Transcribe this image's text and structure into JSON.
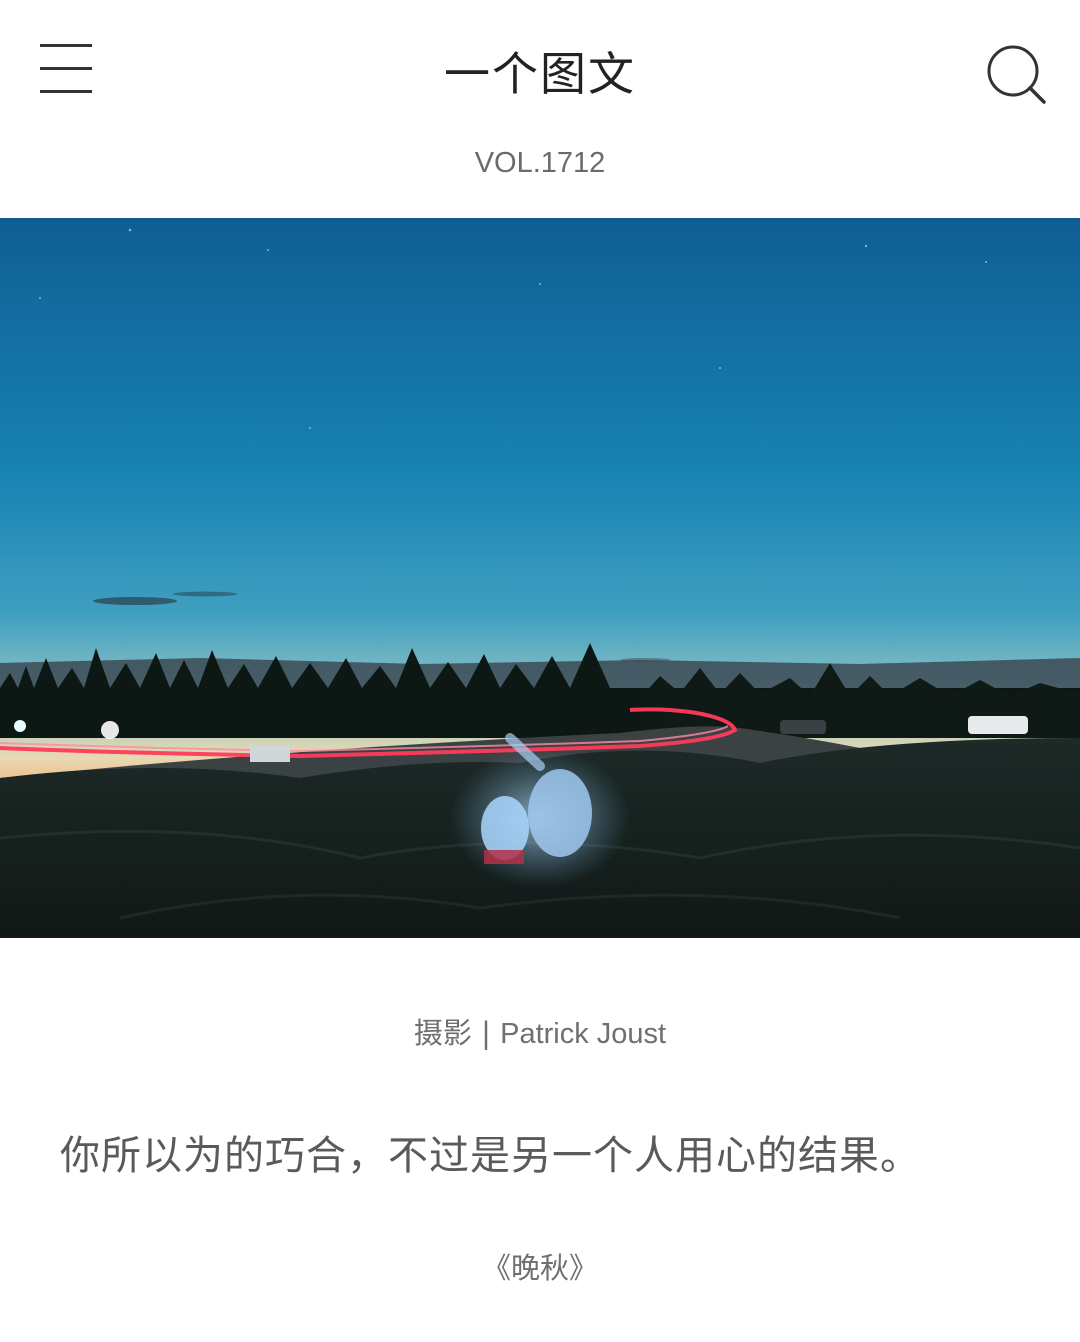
{
  "header": {
    "menu_icon": "hamburger-menu-icon",
    "title": "一个图文",
    "search_icon": "search-icon"
  },
  "issue": {
    "volume": "VOL.1712"
  },
  "photo": {
    "subject": "night-sky-mountain-road-light-trails"
  },
  "credit": {
    "label": "摄影",
    "separator": " | ",
    "author": "Patrick Joust"
  },
  "quote": {
    "text": "你所以为的巧合，不过是另一个人用心的结果。"
  },
  "source": {
    "text": "《晚秋》"
  },
  "colors": {
    "background": "#ffffff",
    "title_text": "#222222",
    "secondary_text": "#6f6f6f"
  }
}
